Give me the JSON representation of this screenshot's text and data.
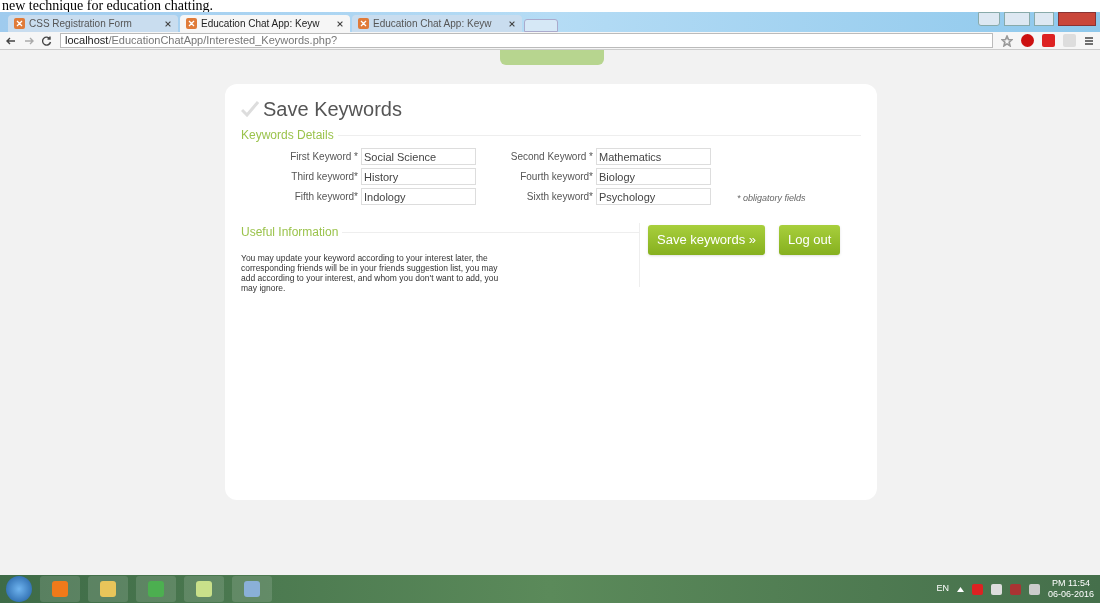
{
  "document_caption": "new technique for education chatting.",
  "tabs": [
    {
      "label": "CSS Registration Form",
      "selected": false
    },
    {
      "label": "Education Chat App: Keyw",
      "selected": true
    },
    {
      "label": "Education Chat App: Keyw",
      "selected": false
    }
  ],
  "address_bar": {
    "host": "localhost",
    "path": "/EducationChatApp/Interested_Keywords.php?"
  },
  "form": {
    "title": "Save Keywords",
    "details_legend": "Keywords Details",
    "fields": [
      {
        "label": "First Keyword *",
        "value": "Social Science"
      },
      {
        "label": "Second Keyword *",
        "value": "Mathematics"
      },
      {
        "label": "Third keyword*",
        "value": "History"
      },
      {
        "label": "Fourth keyword*",
        "value": "Biology"
      },
      {
        "label": "Fifth keyword*",
        "value": "Indology"
      },
      {
        "label": "Sixth keyword*",
        "value": "Psychology"
      }
    ],
    "note": "* obligatory fields",
    "info_legend": "Useful Information",
    "info_text": "You may update your keyword according to your interest later, the corresponding friends will be in your friends suggestion list, you may add according to your interest, and whom you don't want to add, you may ignore.",
    "buttons": [
      "Save keywords »",
      "Log out"
    ]
  },
  "taskbar": {
    "language": "EN",
    "time": "PM 11:54",
    "date": "06-06-2016"
  }
}
